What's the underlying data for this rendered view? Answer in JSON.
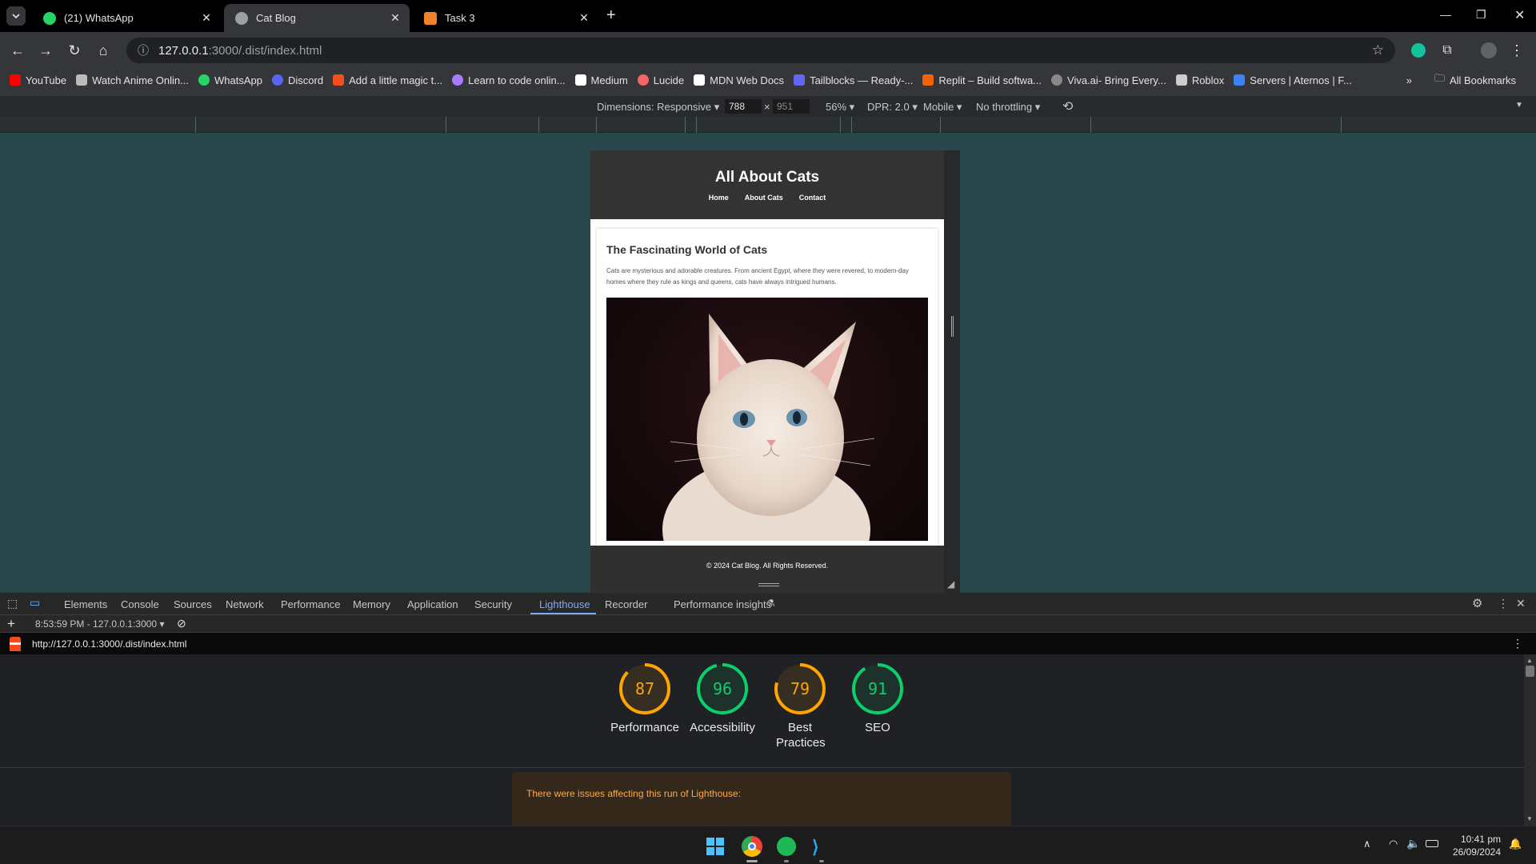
{
  "tabs": [
    {
      "title": "(21) WhatsApp",
      "favicon_color": "#25d366",
      "active": false
    },
    {
      "title": "Cat Blog",
      "favicon_color": "#9aa0a6",
      "active": true
    },
    {
      "title": "Task 3",
      "favicon_color": "#f0822d",
      "active": false
    }
  ],
  "omnibox": {
    "host": "127.0.0.1",
    "path": ":3000/.dist/index.html"
  },
  "bookmarks": [
    {
      "label": "YouTube",
      "color": "#ff0000"
    },
    {
      "label": "Watch Anime Onlin...",
      "color": "#bbbbbb"
    },
    {
      "label": "WhatsApp",
      "color": "#25d366"
    },
    {
      "label": "Discord",
      "color": "#5865f2"
    },
    {
      "label": "Add a little magic t...",
      "color": "#f24e1e"
    },
    {
      "label": "Learn to code onlin...",
      "color": "#a97bff"
    },
    {
      "label": "Medium",
      "color": "#ffffff"
    },
    {
      "label": "Lucide",
      "color": "#f56565"
    },
    {
      "label": "MDN Web Docs",
      "color": "#ffffff"
    },
    {
      "label": "Tailblocks — Ready-...",
      "color": "#6366f1"
    },
    {
      "label": "Replit – Build softwa...",
      "color": "#f26207"
    },
    {
      "label": "Viva.ai- Bring Every...",
      "color": "#888888"
    },
    {
      "label": "Roblox",
      "color": "#cccccc"
    },
    {
      "label": "Servers | Aternos | F...",
      "color": "#3b82f6"
    }
  ],
  "all_bookmarks": "All Bookmarks",
  "device_toolbar": {
    "dimensions": "Dimensions: Responsive",
    "width": "788",
    "height": "951",
    "zoom": "56%",
    "dpr": "DPR: 2.0",
    "device_type": "Mobile",
    "throttling": "No throttling"
  },
  "site": {
    "title": "All About Cats",
    "nav": [
      "Home",
      "About Cats",
      "Contact"
    ],
    "article_title": "The Fascinating World of Cats",
    "article_text": "Cats are mysterious and adorable creatures. From ancient Egypt, where they were revered, to modern-day homes where they rule as kings and queens, cats have always intrigued humans.",
    "footer": "© 2024 Cat Blog. All Rights Reserved."
  },
  "devtools": {
    "tabs": [
      "Elements",
      "Console",
      "Sources",
      "Network",
      "Performance",
      "Memory",
      "Application",
      "Security",
      "Lighthouse",
      "Recorder",
      "Performance insights"
    ],
    "active_tab": "Lighthouse",
    "run_selector": "8:53:59 PM - 127.0.0.1:3000",
    "report_url": "http://127.0.0.1:3000/.dist/index.html",
    "scores": [
      {
        "label": "Performance",
        "value": 87,
        "color": "#ffa400"
      },
      {
        "label": "Accessibility",
        "value": 96,
        "color": "#0cce6b"
      },
      {
        "label": "Best Practices",
        "value": 79,
        "color": "#ffa400"
      },
      {
        "label": "SEO",
        "value": 91,
        "color": "#0cce6b"
      }
    ],
    "warning": "There were issues affecting this run of Lighthouse:"
  },
  "taskbar": {
    "time": "10:41 pm",
    "date": "26/09/2024"
  }
}
